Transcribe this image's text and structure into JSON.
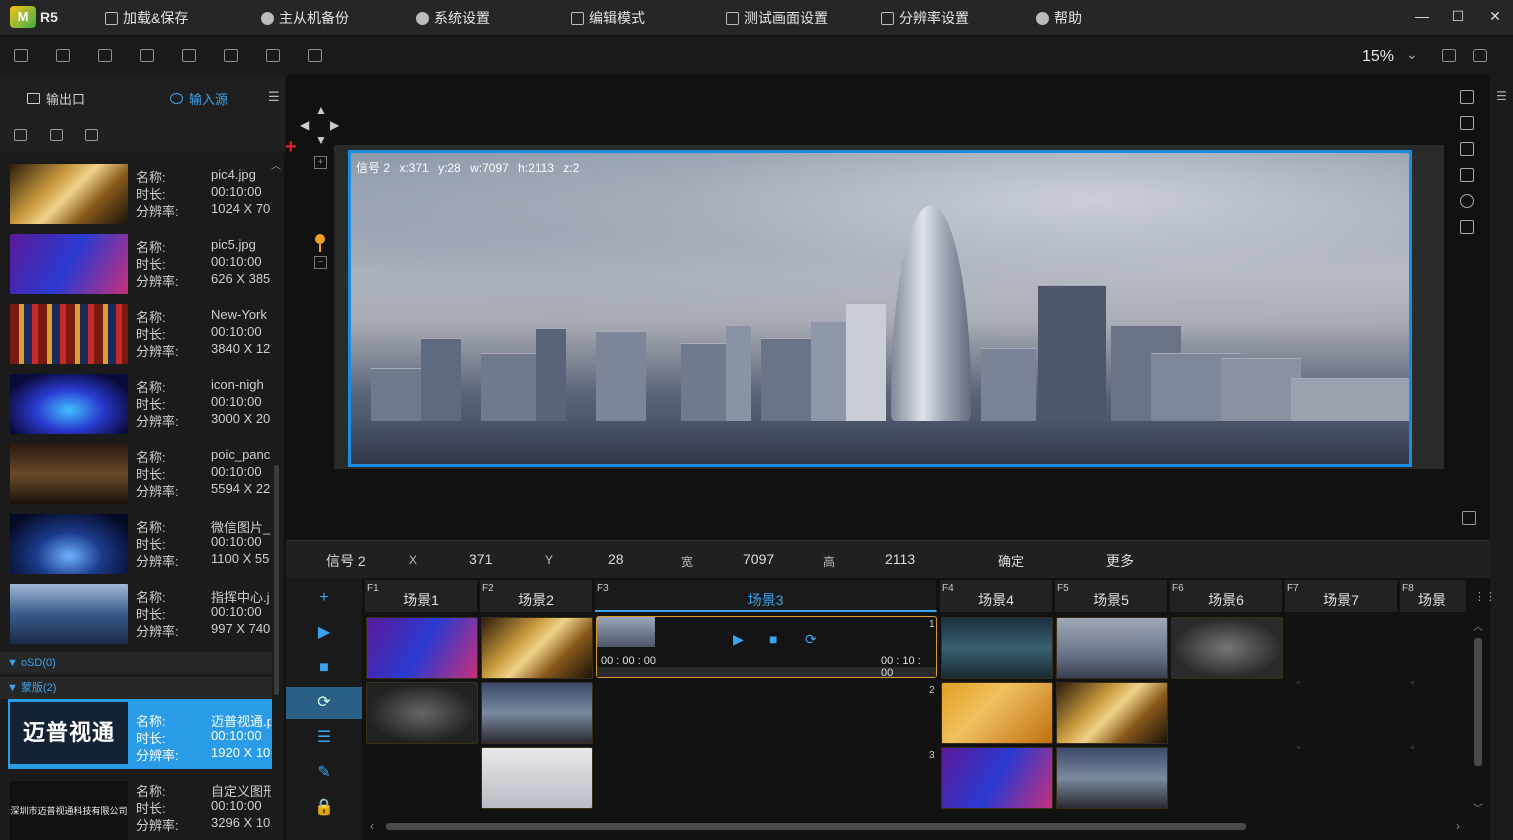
{
  "app": {
    "logo": "R5"
  },
  "menu": [
    {
      "label": "加载&保存",
      "icon": "grid-icon"
    },
    {
      "label": "主从机备份",
      "icon": "backup-icon"
    },
    {
      "label": "系统设置",
      "icon": "gear-icon"
    },
    {
      "label": "编辑模式",
      "icon": "edit-icon"
    },
    {
      "label": "测试画面设置",
      "icon": "test-pattern-icon"
    },
    {
      "label": "分辨率设置",
      "icon": "monitor-icon"
    },
    {
      "label": "帮助",
      "icon": "help-icon"
    }
  ],
  "window": {
    "minimize": "—",
    "maximize": "☐",
    "close": "✕"
  },
  "toolbar": {
    "zoom": "15%"
  },
  "left_panel": {
    "tabs": [
      {
        "label": "输出口"
      },
      {
        "label": "输入源"
      }
    ],
    "media": [
      {
        "name_key": "名称:",
        "dur_key": "时长:",
        "res_key": "分辨率:",
        "name": "pic4.jpg",
        "duration": "00:10:00",
        "resolution": "1024 X 70"
      },
      {
        "name_key": "名称:",
        "dur_key": "时长:",
        "res_key": "分辨率:",
        "name": "pic5.jpg",
        "duration": "00:10:00",
        "resolution": "626 X 385"
      },
      {
        "name_key": "名称:",
        "dur_key": "时长:",
        "res_key": "分辨率:",
        "name": "New-York",
        "duration": "00:10:00",
        "resolution": "3840 X 12"
      },
      {
        "name_key": "名称:",
        "dur_key": "时长:",
        "res_key": "分辨率:",
        "name": "icon-nigh",
        "duration": "00:10:00",
        "resolution": "3000 X 20"
      },
      {
        "name_key": "名称:",
        "dur_key": "时长:",
        "res_key": "分辨率:",
        "name": "poic_panc",
        "duration": "00:10:00",
        "resolution": "5594 X 22"
      },
      {
        "name_key": "名称:",
        "dur_key": "时长:",
        "res_key": "分辨率:",
        "name": "微信图片_",
        "duration": "00:10:00",
        "resolution": "1100 X 55"
      },
      {
        "name_key": "名称:",
        "dur_key": "时长:",
        "res_key": "分辨率:",
        "name": "指挥中心.j",
        "duration": "00:10:00",
        "resolution": "997 X 740"
      }
    ],
    "groups": [
      {
        "label": "▼ oSD(0)"
      },
      {
        "label": "▼ 蒙版(2)"
      }
    ],
    "masks": [
      {
        "thumb_text": "迈普视通",
        "name_key": "名称:",
        "dur_key": "时长:",
        "res_key": "分辨率:",
        "name": "迈普视通.p",
        "duration": "00:10:00",
        "resolution": "1920 X 10"
      },
      {
        "thumb_text": "深圳市迈普视通科技有限公司",
        "name_key": "名称:",
        "dur_key": "时长:",
        "res_key": "分辨率:",
        "name": "自定义图形",
        "duration": "00:10:00",
        "resolution": "3296 X 10"
      }
    ]
  },
  "canvas": {
    "layer_info": {
      "signal": "信号 2",
      "x": "x:371",
      "y": "y:28",
      "w": "w:7097",
      "h": "h:2113",
      "z": "z:2"
    }
  },
  "props": {
    "signal": "信号 2",
    "x_label": "X",
    "x": "371",
    "y_label": "Y",
    "y": "28",
    "w_label": "宽",
    "w": "7097",
    "h_label": "高",
    "h": "2113",
    "confirm": "确定",
    "more": "更多"
  },
  "scenes": [
    {
      "key": "F1",
      "name": "场景1"
    },
    {
      "key": "F2",
      "name": "场景2"
    },
    {
      "key": "F3",
      "name": "场景3"
    },
    {
      "key": "F4",
      "name": "场景4"
    },
    {
      "key": "F5",
      "name": "场景5"
    },
    {
      "key": "F6",
      "name": "场景6"
    },
    {
      "key": "F7",
      "name": "场景7"
    },
    {
      "key": "F8",
      "name": "场景"
    }
  ],
  "player": {
    "start": "00 : 00 : 00",
    "end": "00 : 10 : 00",
    "row": "1"
  },
  "rows": [
    "2",
    "3"
  ],
  "colors": {
    "accent": "#2a9be6",
    "layer_border": "#1b8de0",
    "player_border": "#d89b30"
  }
}
